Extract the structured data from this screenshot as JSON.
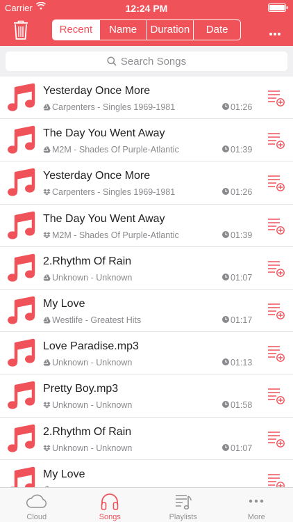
{
  "status_bar": {
    "carrier": "Carrier",
    "time": "12:24 PM"
  },
  "colors": {
    "accent": "#f0525a",
    "muted": "#8a8a8e"
  },
  "header": {
    "segments": [
      "Recent",
      "Name",
      "Duration",
      "Date"
    ],
    "active_segment": "Recent"
  },
  "search": {
    "placeholder": "Search Songs"
  },
  "songs": [
    {
      "title": "Yesterday Once More",
      "subtitle": "Carpenters - Singles 1969-1981",
      "duration": "01:26",
      "source_icon": "cloud-drive-icon"
    },
    {
      "title": "The Day You Went Away",
      "subtitle": "M2M - Shades Of Purple-Atlantic",
      "duration": "01:39",
      "source_icon": "cloud-drive-icon"
    },
    {
      "title": "Yesterday Once More",
      "subtitle": "Carpenters - Singles 1969-1981",
      "duration": "01:26",
      "source_icon": "dropbox-icon"
    },
    {
      "title": "The Day You Went Away",
      "subtitle": "M2M - Shades Of Purple-Atlantic",
      "duration": "01:39",
      "source_icon": "dropbox-icon"
    },
    {
      "title": "2.Rhythm Of Rain",
      "subtitle": "Unknown - Unknown",
      "duration": "01:07",
      "source_icon": "cloud-drive-icon"
    },
    {
      "title": "My Love",
      "subtitle": "Westlife - Greatest Hits",
      "duration": "01:17",
      "source_icon": "cloud-drive-icon"
    },
    {
      "title": "Love Paradise.mp3",
      "subtitle": "Unknown - Unknown",
      "duration": "01:13",
      "source_icon": "cloud-drive-icon"
    },
    {
      "title": "Pretty Boy.mp3",
      "subtitle": "Unknown - Unknown",
      "duration": "01:58",
      "source_icon": "dropbox-icon"
    },
    {
      "title": "2.Rhythm Of Rain",
      "subtitle": "Unknown - Unknown",
      "duration": "01:07",
      "source_icon": "dropbox-icon"
    },
    {
      "title": "My Love",
      "subtitle": "",
      "duration": "",
      "source_icon": "cloud-drive-icon"
    }
  ],
  "tabbar": {
    "items": [
      {
        "label": "Cloud",
        "icon": "cloud-icon"
      },
      {
        "label": "Songs",
        "icon": "headphones-icon"
      },
      {
        "label": "Playlists",
        "icon": "playlist-icon"
      },
      {
        "label": "More",
        "icon": "more-dots-icon"
      }
    ],
    "active": "Songs"
  }
}
